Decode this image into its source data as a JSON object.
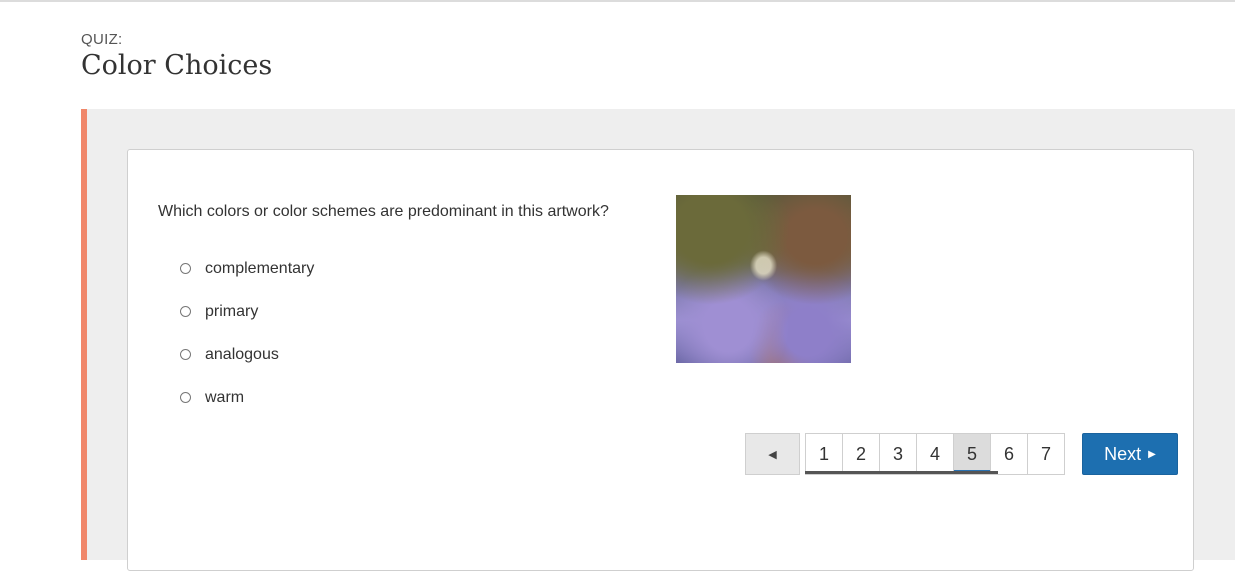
{
  "header": {
    "label": "QUIZ:",
    "title": "Color Choices"
  },
  "question": {
    "text": "Which colors or color schemes are predominant in this artwork?",
    "options": [
      {
        "label": "complementary",
        "selected": false
      },
      {
        "label": "primary",
        "selected": false
      },
      {
        "label": "analogous",
        "selected": false
      },
      {
        "label": "warm",
        "selected": false
      }
    ],
    "artwork_icon": "painting-image"
  },
  "pagination": {
    "prev_glyph": "◀",
    "pages": [
      "1",
      "2",
      "3",
      "4",
      "5",
      "6",
      "7"
    ],
    "current_page": "5",
    "next_label": "Next",
    "next_glyph": "▶"
  },
  "colors": {
    "accent": "#f0876a",
    "primary_button": "#1d6fb0"
  }
}
